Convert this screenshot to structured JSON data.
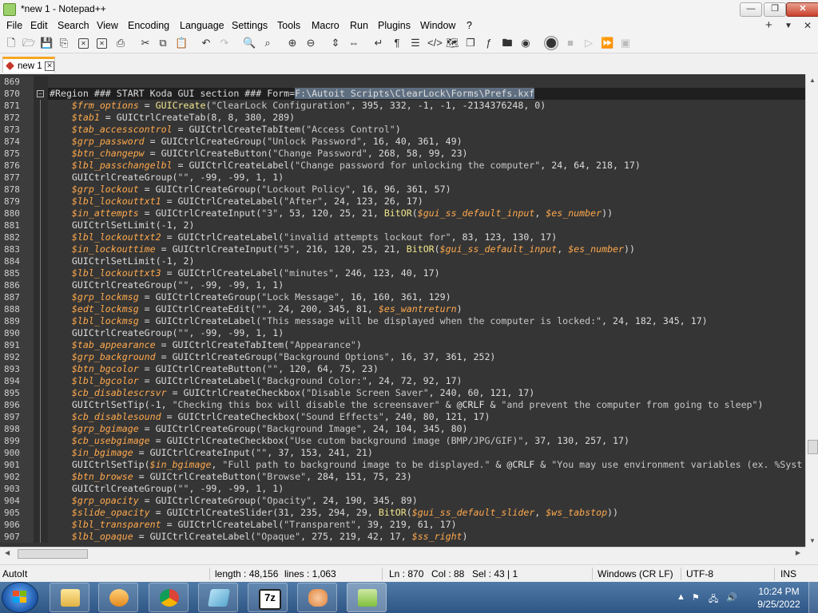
{
  "window": {
    "title": "*new 1 - Notepad++",
    "minimize": "—",
    "maximize": "❐",
    "close": "✕"
  },
  "menu": {
    "items": [
      "File",
      "Edit",
      "Search",
      "View",
      "Encoding",
      "Language",
      "Settings",
      "Tools",
      "Macro",
      "Run",
      "Plugins",
      "Window",
      "?"
    ],
    "right_plus": "+",
    "right_dropdown": "▼",
    "right_close": "✕"
  },
  "toolbar": {
    "icons": [
      "new-file-icon",
      "open-file-icon",
      "save-icon",
      "save-all-icon",
      "close-icon",
      "close-all-icon",
      "print-icon",
      "cut-icon",
      "copy-icon",
      "paste-icon",
      "undo-icon",
      "redo-icon",
      "find-icon",
      "replace-icon",
      "zoom-in-icon",
      "zoom-out-icon",
      "sync-vertical-icon",
      "sync-horizontal-icon",
      "word-wrap-icon",
      "show-all-characters-icon",
      "indent-guide-icon",
      "udl-icon",
      "document-map-icon",
      "document-list-icon",
      "function-list-icon",
      "folder-as-workspace-icon",
      "monitoring-icon",
      "record-macro-icon",
      "stop-record-icon",
      "play-macro-icon",
      "run-multiple-icon",
      "save-macro-icon"
    ]
  },
  "tab": {
    "label": "new 1",
    "close": "✕"
  },
  "editor": {
    "lines": [
      {
        "num": "869",
        "segs": [
          [
            "n",
            ""
          ]
        ]
      },
      {
        "num": "870",
        "fold": "box",
        "current": true,
        "segs": [
          [
            "n",
            "#Region ### START Koda GUI section ### Form="
          ],
          [
            "sel",
            "F:\\Autoit Scripts\\ClearLock\\Forms\\Prefs.kxf"
          ]
        ]
      },
      {
        "num": "871",
        "segs": [
          [
            "n",
            "    "
          ],
          [
            "v",
            "$frm_options"
          ],
          [
            "n",
            " = "
          ],
          [
            "m",
            "GUICreate"
          ],
          [
            "n",
            "("
          ],
          [
            "s",
            "\"ClearLock Configuration\""
          ],
          [
            "n",
            ", 395, 332, -1, -1, -2134376248, 0)"
          ]
        ]
      },
      {
        "num": "872",
        "segs": [
          [
            "n",
            "    "
          ],
          [
            "v",
            "$tab1"
          ],
          [
            "n",
            " = GUICtrlCreateTab(8, 8, 380, 289)"
          ]
        ]
      },
      {
        "num": "873",
        "segs": [
          [
            "n",
            "    "
          ],
          [
            "v",
            "$tab_accesscontrol"
          ],
          [
            "n",
            " = GUICtrlCreateTabItem("
          ],
          [
            "s",
            "\"Access Control\""
          ],
          [
            "n",
            ")"
          ]
        ]
      },
      {
        "num": "874",
        "segs": [
          [
            "n",
            "    "
          ],
          [
            "v",
            "$grp_password"
          ],
          [
            "n",
            " = GUICtrlCreateGroup("
          ],
          [
            "s",
            "\"Unlock Password\""
          ],
          [
            "n",
            ", 16, 40, 361, 49)"
          ]
        ]
      },
      {
        "num": "875",
        "segs": [
          [
            "n",
            "    "
          ],
          [
            "v",
            "$btn_changepw"
          ],
          [
            "n",
            " = GUICtrlCreateButton("
          ],
          [
            "s",
            "\"Change Password\""
          ],
          [
            "n",
            ", 268, 58, 99, 23)"
          ]
        ]
      },
      {
        "num": "876",
        "segs": [
          [
            "n",
            "    "
          ],
          [
            "v",
            "$lbl_passchangelbl"
          ],
          [
            "n",
            " = GUICtrlCreateLabel("
          ],
          [
            "s",
            "\"Change password for unlocking the computer\""
          ],
          [
            "n",
            ", 24, 64, 218, 17)"
          ]
        ]
      },
      {
        "num": "877",
        "segs": [
          [
            "n",
            "    GUICtrlCreateGroup("
          ],
          [
            "s",
            "\"\""
          ],
          [
            "n",
            ", -99, -99, 1, 1)"
          ]
        ]
      },
      {
        "num": "878",
        "segs": [
          [
            "n",
            "    "
          ],
          [
            "v",
            "$grp_lockout"
          ],
          [
            "n",
            " = GUICtrlCreateGroup("
          ],
          [
            "s",
            "\"Lockout Policy\""
          ],
          [
            "n",
            ", 16, 96, 361, 57)"
          ]
        ]
      },
      {
        "num": "879",
        "segs": [
          [
            "n",
            "    "
          ],
          [
            "v",
            "$lbl_lockouttxt1"
          ],
          [
            "n",
            " = GUICtrlCreateLabel("
          ],
          [
            "s",
            "\"After\""
          ],
          [
            "n",
            ", 24, 123, 26, 17)"
          ]
        ]
      },
      {
        "num": "880",
        "segs": [
          [
            "n",
            "    "
          ],
          [
            "v",
            "$in_attempts"
          ],
          [
            "n",
            " = GUICtrlCreateInput("
          ],
          [
            "s",
            "\"3\""
          ],
          [
            "n",
            ", 53, 120, 25, 21, "
          ],
          [
            "m",
            "BitOR"
          ],
          [
            "n",
            "("
          ],
          [
            "v",
            "$gui_ss_default_input"
          ],
          [
            "n",
            ", "
          ],
          [
            "v",
            "$es_number"
          ],
          [
            "n",
            "))"
          ]
        ]
      },
      {
        "num": "881",
        "segs": [
          [
            "n",
            "    GUICtrlSetLimit(-1, 2)"
          ]
        ]
      },
      {
        "num": "882",
        "segs": [
          [
            "n",
            "    "
          ],
          [
            "v",
            "$lbl_lockouttxt2"
          ],
          [
            "n",
            " = GUICtrlCreateLabel("
          ],
          [
            "s",
            "\"invalid attempts lockout for\""
          ],
          [
            "n",
            ", 83, 123, 130, 17)"
          ]
        ]
      },
      {
        "num": "883",
        "segs": [
          [
            "n",
            "    "
          ],
          [
            "v",
            "$in_lockouttime"
          ],
          [
            "n",
            " = GUICtrlCreateInput("
          ],
          [
            "s",
            "\"5\""
          ],
          [
            "n",
            ", 216, 120, 25, 21, "
          ],
          [
            "m",
            "BitOR"
          ],
          [
            "n",
            "("
          ],
          [
            "v",
            "$gui_ss_default_input"
          ],
          [
            "n",
            ", "
          ],
          [
            "v",
            "$es_number"
          ],
          [
            "n",
            "))"
          ]
        ]
      },
      {
        "num": "884",
        "segs": [
          [
            "n",
            "    GUICtrlSetLimit(-1, 2)"
          ]
        ]
      },
      {
        "num": "885",
        "segs": [
          [
            "n",
            "    "
          ],
          [
            "v",
            "$lbl_lockouttxt3"
          ],
          [
            "n",
            " = GUICtrlCreateLabel("
          ],
          [
            "s",
            "\"minutes\""
          ],
          [
            "n",
            ", 246, 123, 40, 17)"
          ]
        ]
      },
      {
        "num": "886",
        "segs": [
          [
            "n",
            "    GUICtrlCreateGroup("
          ],
          [
            "s",
            "\"\""
          ],
          [
            "n",
            ", -99, -99, 1, 1)"
          ]
        ]
      },
      {
        "num": "887",
        "segs": [
          [
            "n",
            "    "
          ],
          [
            "v",
            "$grp_lockmsg"
          ],
          [
            "n",
            " = GUICtrlCreateGroup("
          ],
          [
            "s",
            "\"Lock Message\""
          ],
          [
            "n",
            ", 16, 160, 361, 129)"
          ]
        ]
      },
      {
        "num": "888",
        "segs": [
          [
            "n",
            "    "
          ],
          [
            "v",
            "$edt_lockmsg"
          ],
          [
            "n",
            " = GUICtrlCreateEdit("
          ],
          [
            "s",
            "\"\""
          ],
          [
            "n",
            ", 24, 200, 345, 81, "
          ],
          [
            "v",
            "$es_wantreturn"
          ],
          [
            "n",
            ")"
          ]
        ]
      },
      {
        "num": "889",
        "segs": [
          [
            "n",
            "    "
          ],
          [
            "v",
            "$lbl_lockmsg"
          ],
          [
            "n",
            " = GUICtrlCreateLabel("
          ],
          [
            "s",
            "\"This message will be displayed when the computer is locked:\""
          ],
          [
            "n",
            ", 24, 182, 345, 17)"
          ]
        ]
      },
      {
        "num": "890",
        "segs": [
          [
            "n",
            "    GUICtrlCreateGroup("
          ],
          [
            "s",
            "\"\""
          ],
          [
            "n",
            ", -99, -99, 1, 1)"
          ]
        ]
      },
      {
        "num": "891",
        "segs": [
          [
            "n",
            "    "
          ],
          [
            "v",
            "$tab_appearance"
          ],
          [
            "n",
            " = GUICtrlCreateTabItem("
          ],
          [
            "s",
            "\"Appearance\""
          ],
          [
            "n",
            ")"
          ]
        ]
      },
      {
        "num": "892",
        "segs": [
          [
            "n",
            "    "
          ],
          [
            "v",
            "$grp_background"
          ],
          [
            "n",
            " = GUICtrlCreateGroup("
          ],
          [
            "s",
            "\"Background Options\""
          ],
          [
            "n",
            ", 16, 37, 361, 252)"
          ]
        ]
      },
      {
        "num": "893",
        "segs": [
          [
            "n",
            "    "
          ],
          [
            "v",
            "$btn_bgcolor"
          ],
          [
            "n",
            " = GUICtrlCreateButton("
          ],
          [
            "s",
            "\"\""
          ],
          [
            "n",
            ", 120, 64, 75, 23)"
          ]
        ]
      },
      {
        "num": "894",
        "segs": [
          [
            "n",
            "    "
          ],
          [
            "v",
            "$lbl_bgcolor"
          ],
          [
            "n",
            " = GUICtrlCreateLabel("
          ],
          [
            "s",
            "\"Background Color:\""
          ],
          [
            "n",
            ", 24, 72, 92, 17)"
          ]
        ]
      },
      {
        "num": "895",
        "segs": [
          [
            "n",
            "    "
          ],
          [
            "v",
            "$cb_disablescrsvr"
          ],
          [
            "n",
            " = GUICtrlCreateCheckbox("
          ],
          [
            "s",
            "\"Disable Screen Saver\""
          ],
          [
            "n",
            ", 240, 60, 121, 17)"
          ]
        ]
      },
      {
        "num": "896",
        "segs": [
          [
            "n",
            "    GUICtrlSetTip(-1, "
          ],
          [
            "s",
            "\"Checking this box will disable the screensaver\""
          ],
          [
            "n",
            " & "
          ],
          [
            "o",
            "@CRLF"
          ],
          [
            "n",
            " & "
          ],
          [
            "s",
            "\"and prevent the computer from going to sleep\""
          ],
          [
            "n",
            ")"
          ]
        ]
      },
      {
        "num": "897",
        "segs": [
          [
            "n",
            "    "
          ],
          [
            "v",
            "$cb_disablesound"
          ],
          [
            "n",
            " = GUICtrlCreateCheckbox("
          ],
          [
            "s",
            "\"Sound Effects\""
          ],
          [
            "n",
            ", 240, 80, 121, 17)"
          ]
        ]
      },
      {
        "num": "898",
        "segs": [
          [
            "n",
            "    "
          ],
          [
            "v",
            "$grp_bgimage"
          ],
          [
            "n",
            " = GUICtrlCreateGroup("
          ],
          [
            "s",
            "\"Background Image\""
          ],
          [
            "n",
            ", 24, 104, 345, 80)"
          ]
        ]
      },
      {
        "num": "899",
        "segs": [
          [
            "n",
            "    "
          ],
          [
            "v",
            "$cb_usebgimage"
          ],
          [
            "n",
            " = GUICtrlCreateCheckbox("
          ],
          [
            "s",
            "\"Use cutom background image (BMP/JPG/GIF)\""
          ],
          [
            "n",
            ", 37, 130, 257, 17)"
          ]
        ]
      },
      {
        "num": "900",
        "segs": [
          [
            "n",
            "    "
          ],
          [
            "v",
            "$in_bgimage"
          ],
          [
            "n",
            " = GUICtrlCreateInput("
          ],
          [
            "s",
            "\"\""
          ],
          [
            "n",
            ", 37, 153, 241, 21)"
          ]
        ]
      },
      {
        "num": "901",
        "segs": [
          [
            "n",
            "    GUICtrlSetTip("
          ],
          [
            "v",
            "$in_bgimage"
          ],
          [
            "n",
            ", "
          ],
          [
            "s",
            "\"Full path to background image to be displayed.\""
          ],
          [
            "n",
            " & "
          ],
          [
            "o",
            "@CRLF"
          ],
          [
            "n",
            " & "
          ],
          [
            "s",
            "\"You may use environment variables (ex. %Syst"
          ]
        ]
      },
      {
        "num": "902",
        "segs": [
          [
            "n",
            "    "
          ],
          [
            "v",
            "$btn_browse"
          ],
          [
            "n",
            " = GUICtrlCreateButton("
          ],
          [
            "s",
            "\"Browse\""
          ],
          [
            "n",
            ", 284, 151, 75, 23)"
          ]
        ]
      },
      {
        "num": "903",
        "segs": [
          [
            "n",
            "    GUICtrlCreateGroup("
          ],
          [
            "s",
            "\"\""
          ],
          [
            "n",
            ", -99, -99, 1, 1)"
          ]
        ]
      },
      {
        "num": "904",
        "segs": [
          [
            "n",
            "    "
          ],
          [
            "v",
            "$grp_opacity"
          ],
          [
            "n",
            " = GUICtrlCreateGroup("
          ],
          [
            "s",
            "\"Opacity\""
          ],
          [
            "n",
            ", 24, 190, 345, 89)"
          ]
        ]
      },
      {
        "num": "905",
        "segs": [
          [
            "n",
            "    "
          ],
          [
            "v",
            "$slide_opacity"
          ],
          [
            "n",
            " = GUICtrlCreateSlider(31, 235, 294, 29, "
          ],
          [
            "m",
            "BitOR"
          ],
          [
            "n",
            "("
          ],
          [
            "v",
            "$gui_ss_default_slider"
          ],
          [
            "n",
            ", "
          ],
          [
            "v",
            "$ws_tabstop"
          ],
          [
            "n",
            "))"
          ]
        ]
      },
      {
        "num": "906",
        "segs": [
          [
            "n",
            "    "
          ],
          [
            "v",
            "$lbl_transparent"
          ],
          [
            "n",
            " = GUICtrlCreateLabel("
          ],
          [
            "s",
            "\"Transparent\""
          ],
          [
            "n",
            ", 39, 219, 61, 17)"
          ]
        ]
      },
      {
        "num": "907",
        "segs": [
          [
            "n",
            "    "
          ],
          [
            "v",
            "$lbl_opaque"
          ],
          [
            "n",
            " = GUICtrlCreateLabel("
          ],
          [
            "s",
            "\"Opaque\""
          ],
          [
            "n",
            ", 275, 219, 42, 17, "
          ],
          [
            "v",
            "$ss_right"
          ],
          [
            "n",
            ")"
          ]
        ]
      }
    ]
  },
  "statusbar": {
    "language": "AutoIt",
    "length": "length : 48,156",
    "lines": "lines : 1,063",
    "ln": "Ln : 870",
    "col": "Col : 88",
    "sel": "Sel : 43 | 1",
    "eol": "Windows (CR LF)",
    "encoding": "UTF-8",
    "mode": "INS"
  },
  "taskbar": {
    "apps": [
      "file-explorer-icon",
      "media-player-icon",
      "chrome-icon",
      "notepad-icon",
      "7zip-icon",
      "fox-icon",
      "notepad-plus-plus-icon"
    ],
    "zip_label": "7z",
    "time": "10:24 PM",
    "date": "9/25/2022"
  },
  "colors": {
    "editor_bg": "#353535",
    "variable": "#ffa94d",
    "tab_accent": "#f5a623"
  }
}
